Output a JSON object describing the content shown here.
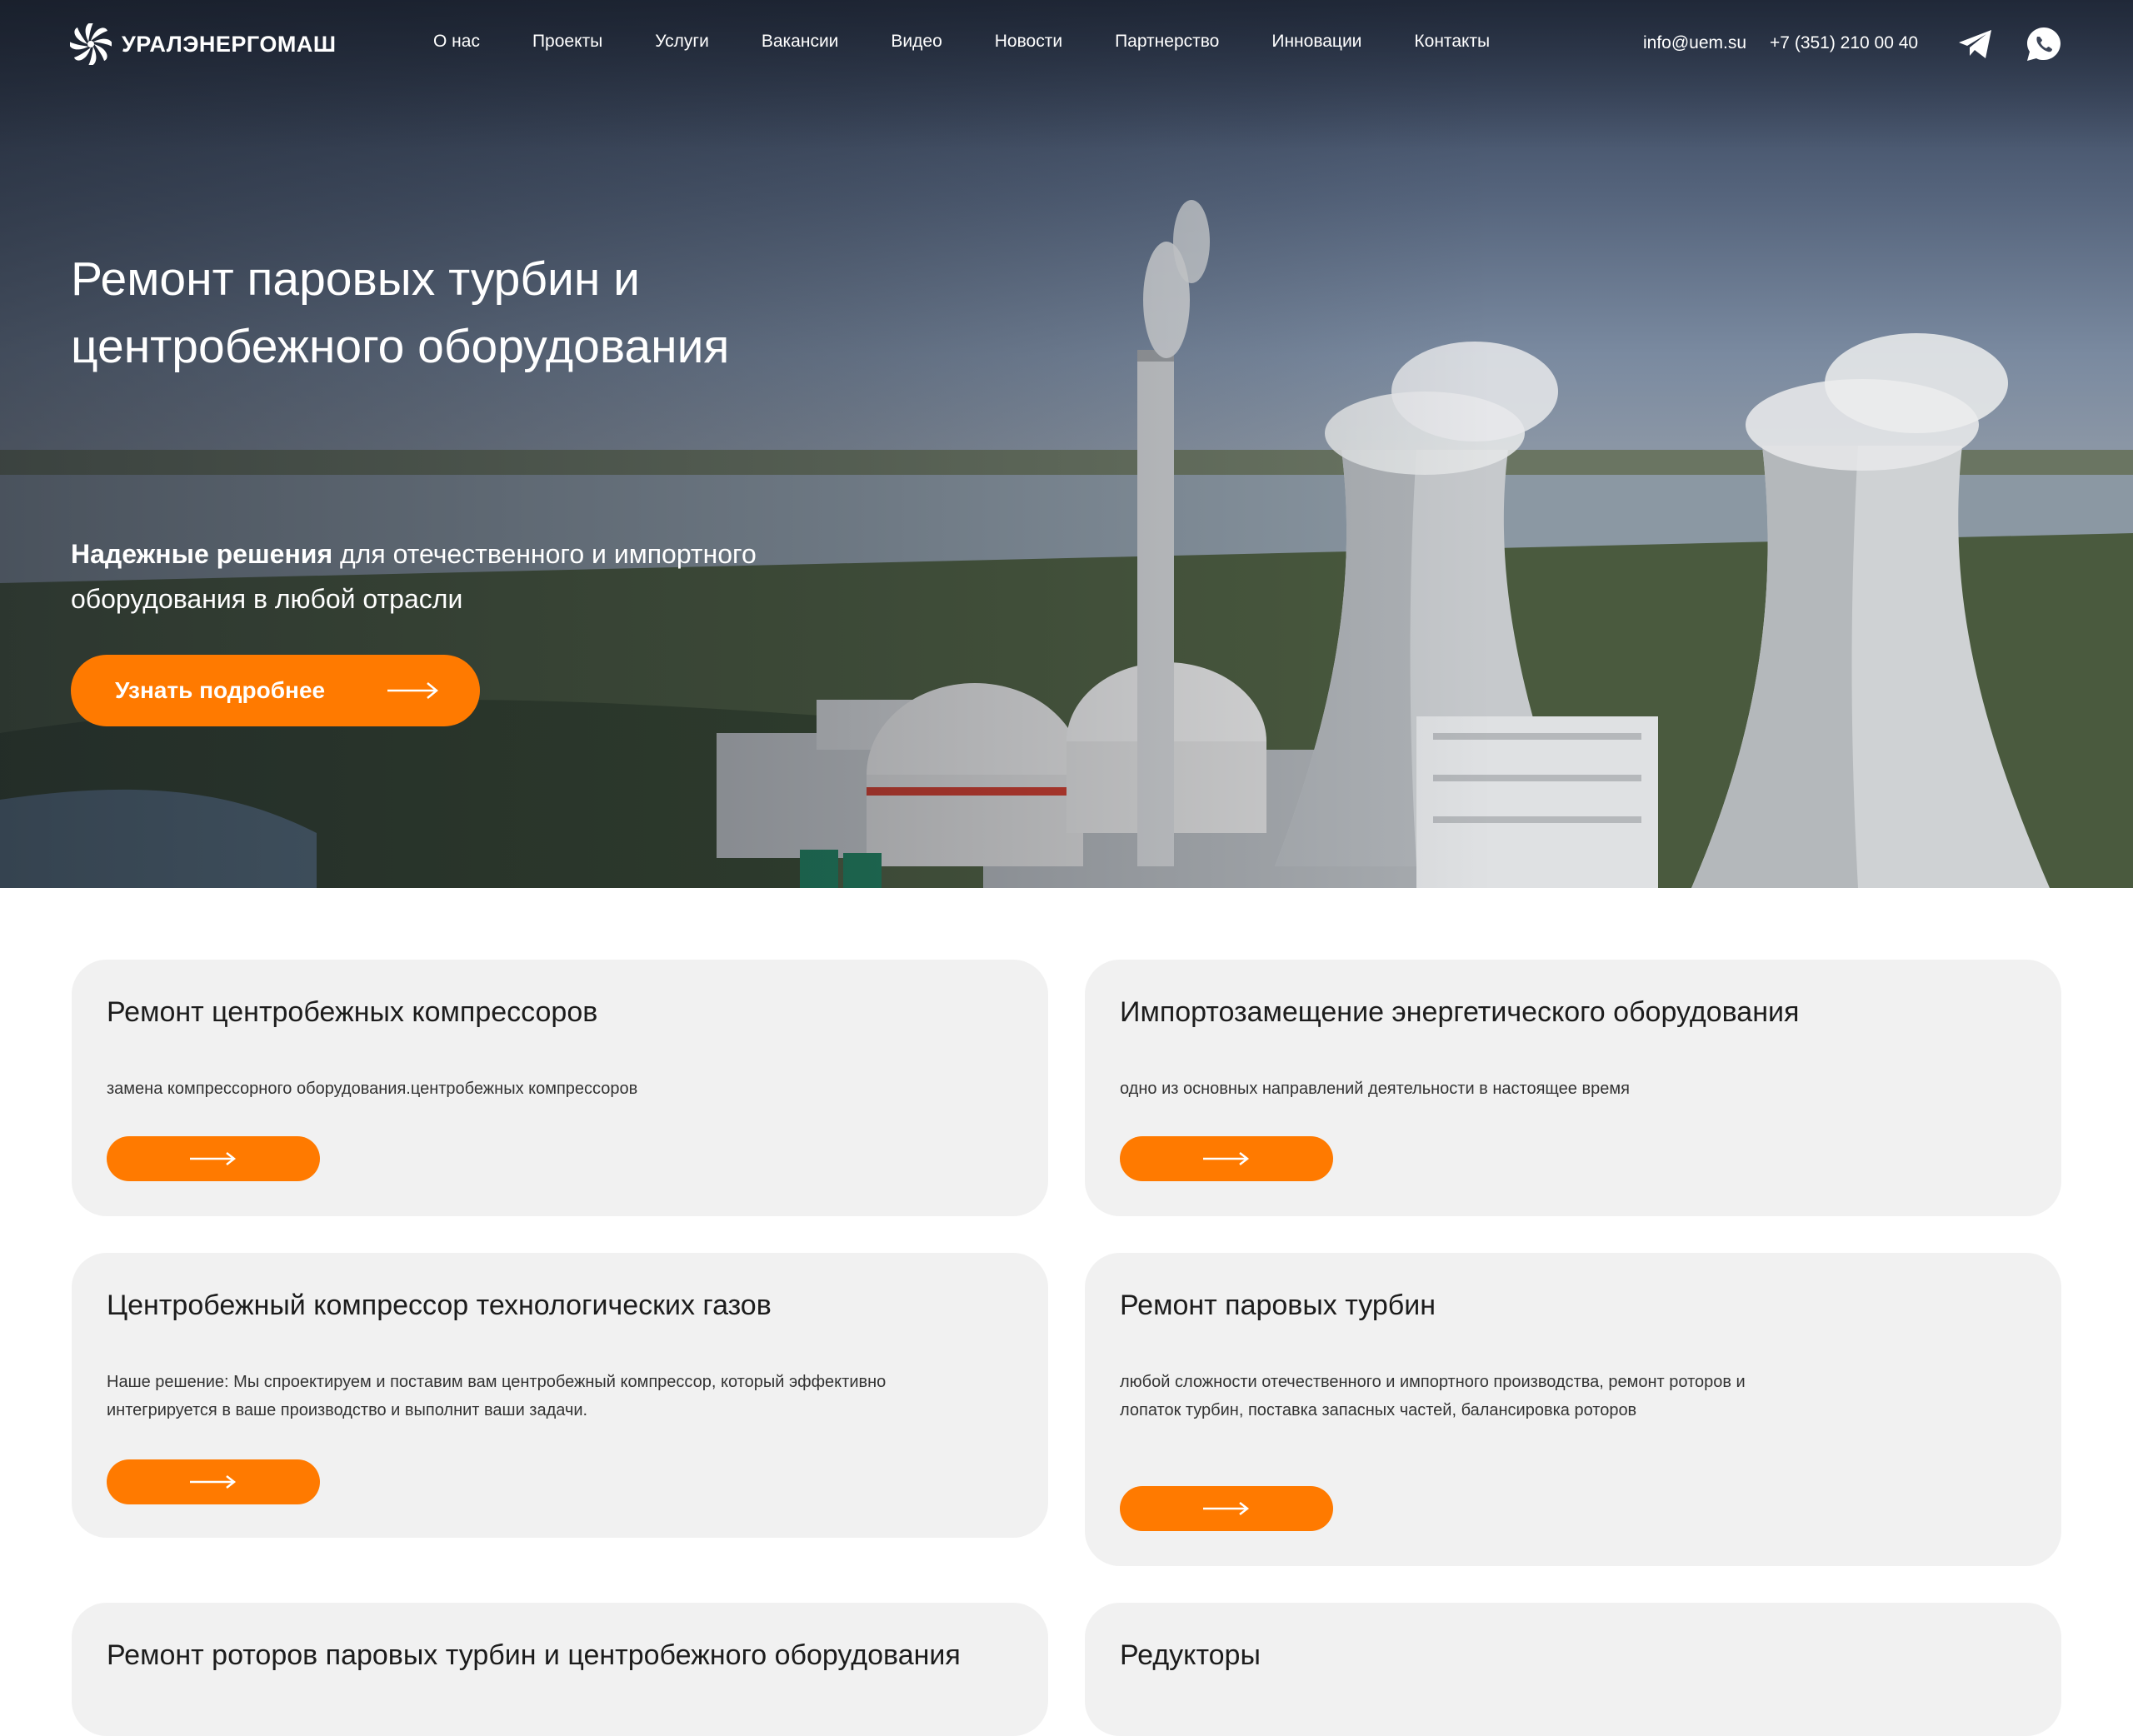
{
  "header": {
    "logo_text": "УРАЛЭНЕРГОМАШ",
    "nav": [
      "О нас",
      "Проекты",
      "Услуги",
      "Вакансии",
      "Видео",
      "Новости",
      "Партнерство",
      "Инновации",
      "Контакты"
    ],
    "email": "info@uem.su",
    "phone": "+7 (351) 210 00 40",
    "social_icons": [
      "telegram-icon",
      "whatsapp-icon"
    ]
  },
  "hero": {
    "title": "Ремонт паровых турбин и центробежного оборудования",
    "subtitle_bold": "Надежные решения",
    "subtitle_rest": " для отечественного и импортного оборудования в любой отрасли",
    "button_label": "Узнать подробнее"
  },
  "cards": [
    {
      "title": "Ремонт центробежных компрессоров",
      "description": "замена компрессорного оборудования.центробежных компрессоров"
    },
    {
      "title": "Импортозамещение энергетического оборудования",
      "description": "одно из основных направлений деятельности в настоящее время"
    },
    {
      "title": "Центробежный компрессор технологических газов",
      "description": "Наше решение: Мы спроектируем и поставим вам центробежный компрессор, который эффективно интегрируется в ваше производство и выполнит ваши задачи."
    },
    {
      "title": "Ремонт паровых турбин",
      "description": "любой сложности отечественного и импортного производства, ремонт роторов и лопаток турбин, поставка запасных частей, балансировка роторов"
    },
    {
      "title": "Ремонт роторов паровых турбин и центробежного оборудования",
      "description": ""
    },
    {
      "title": "Редукторы",
      "description": ""
    }
  ],
  "colors": {
    "accent": "#ff7a00",
    "card_bg": "#f1f1f1",
    "text_dark": "#1c1c1c"
  }
}
